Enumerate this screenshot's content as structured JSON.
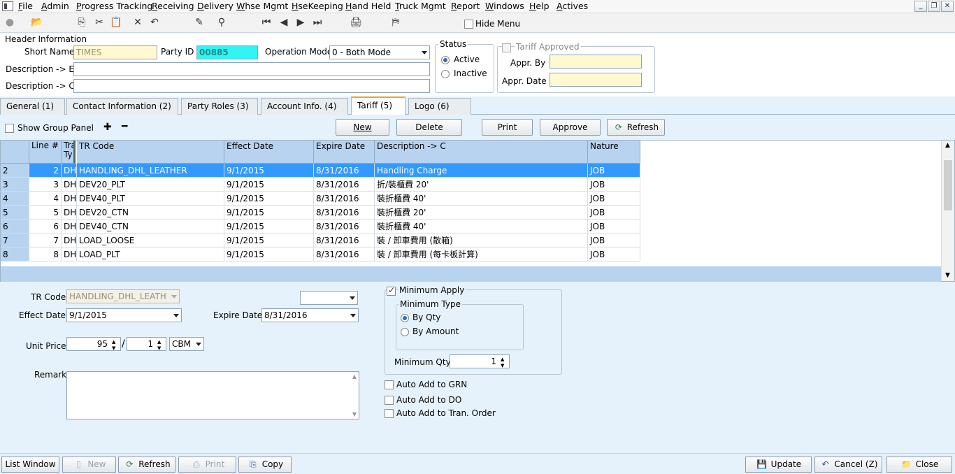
{
  "menu": {
    "items": [
      "File",
      "Admin",
      "Progress Tracking",
      "Receiving",
      "Delivery",
      "Whse Mgmt",
      "HseKeeping",
      "Hand Held",
      "Truck Mgmt",
      "Report",
      "Windows",
      "Help",
      "Actives"
    ]
  },
  "toolbar": {
    "hide_menu_label": "Hide Menu"
  },
  "header": {
    "title": "Header Information",
    "short_name_label": "Short Name",
    "short_name_value": "TIMES",
    "party_id_label": "Party ID",
    "party_id_value": "00885",
    "operation_mode_label": "Operation Mode",
    "operation_mode_value": "0 - Both Mode",
    "desc_e_label": "Description  -> E",
    "desc_c_label": "Description  -> C",
    "status_title": "Status",
    "status_active": "Active",
    "status_inactive": "Inactive",
    "tariff_approved_label": "Tariff Approved",
    "appr_by_label": "Appr. By",
    "appr_date_label": "Appr. Date"
  },
  "tabs": [
    {
      "label": "General  (1)"
    },
    {
      "label": "Contact Information  (2)"
    },
    {
      "label": "Party Roles  (3)"
    },
    {
      "label": "Account Info.  (4)"
    },
    {
      "label": "Tariff  (5)"
    },
    {
      "label": "Logo  (6)"
    }
  ],
  "grid_toolbar": {
    "show_group_panel": "Show Group Panel",
    "new": "New",
    "delete": "Delete",
    "print": "Print",
    "approve": "Approve",
    "refresh": "Refresh"
  },
  "grid": {
    "headers": {
      "line": "Line #",
      "type": "Tra Ty",
      "tr_code": "TR Code",
      "effect_date": "Effect Date",
      "expire_date": "Expire Date",
      "description": "Description -> C",
      "nature": "Nature"
    },
    "rows": [
      {
        "rownum": "2",
        "line": "2",
        "type": "DHL",
        "tr_code": "HANDLING_DHL_LEATHER",
        "effect": "9/1/2015",
        "expire": "8/31/2016",
        "desc": "Handling Charge",
        "nature": "JOB"
      },
      {
        "rownum": "3",
        "line": "3",
        "type": "DHL",
        "tr_code": "DEV20_PLT",
        "effect": "9/1/2015",
        "expire": "8/31/2016",
        "desc": "折/裝櫃費 20'",
        "nature": "JOB"
      },
      {
        "rownum": "4",
        "line": "4",
        "type": "DHL",
        "tr_code": "DEV40_PLT",
        "effect": "9/1/2015",
        "expire": "8/31/2016",
        "desc": "裝折櫃費 40'",
        "nature": "JOB"
      },
      {
        "rownum": "5",
        "line": "5",
        "type": "DHL",
        "tr_code": "DEV20_CTN",
        "effect": "9/1/2015",
        "expire": "8/31/2016",
        "desc": "裝折櫃費 20'",
        "nature": "JOB"
      },
      {
        "rownum": "6",
        "line": "6",
        "type": "DHL",
        "tr_code": "DEV40_CTN",
        "effect": "9/1/2015",
        "expire": "8/31/2016",
        "desc": "裝折櫃費 40'",
        "nature": "JOB"
      },
      {
        "rownum": "7",
        "line": "7",
        "type": "DHL",
        "tr_code": "LOAD_LOOSE",
        "effect": "9/1/2015",
        "expire": "8/31/2016",
        "desc": "裝 / 卸車費用 (散箱)",
        "nature": "JOB"
      },
      {
        "rownum": "8",
        "line": "8",
        "type": "DHL",
        "tr_code": "LOAD_PLT",
        "effect": "9/1/2015",
        "expire": "8/31/2016",
        "desc": "裝 / 卸車費用 (每卡板計算)",
        "nature": "JOB"
      }
    ]
  },
  "detail": {
    "tr_code_label": "TR Code",
    "tr_code_value": "HANDLING_DHL_LEATHER",
    "effect_date_label": "Effect Date",
    "effect_date_value": "9/1/2015",
    "expire_date_label": "Expire Date",
    "expire_date_value": "8/31/2016",
    "unit_price_label": "Unit Price",
    "unit_price_value": "95",
    "per_qty_value": "1",
    "unit_value": "CBM",
    "remark_label": "Remark",
    "minimum_apply_label": "Minimum Apply",
    "minimum_type_title": "Minimum Type",
    "by_qty": "By Qty",
    "by_amount": "By Amount",
    "minimum_qty_label": "Minimum Qty",
    "minimum_qty_value": "1",
    "auto_grn": "Auto Add to GRN",
    "auto_do": "Auto Add to DO",
    "auto_tran": "Auto Add to Tran. Order"
  },
  "bottom": {
    "list_window": "List Window",
    "new": "New",
    "refresh": "Refresh",
    "print": "Print",
    "copy": "Copy",
    "update": "Update",
    "cancel": "Cancel (Z)",
    "close": "Close"
  }
}
